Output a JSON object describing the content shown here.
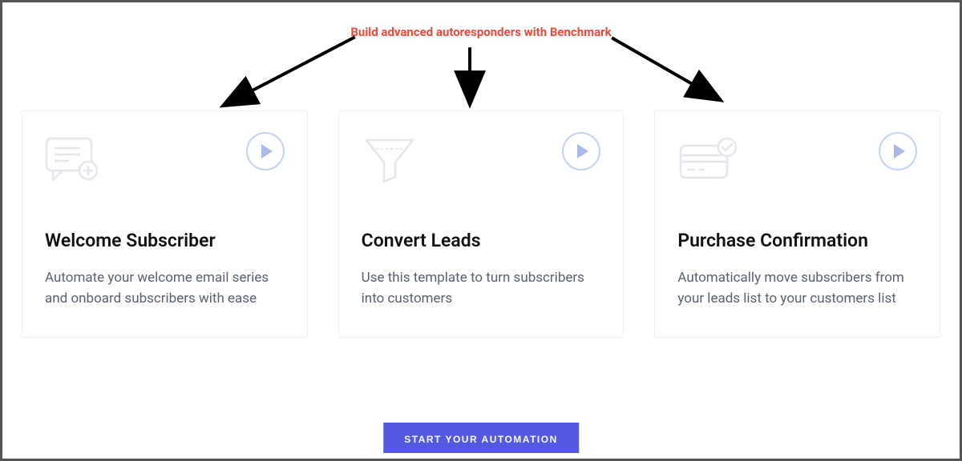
{
  "annotation": {
    "title": "Build advanced autoresponders with Benchmark"
  },
  "cards": [
    {
      "icon": "chat-plus-icon",
      "title": "Welcome Subscriber",
      "description": "Automate your welcome email series and onboard subscribers with ease"
    },
    {
      "icon": "funnel-icon",
      "title": "Convert Leads",
      "description": "Use this template to turn subscribers into customers"
    },
    {
      "icon": "card-check-icon",
      "title": "Purchase Confirmation",
      "description": "Automatically move subscribers from your leads list to your customers list"
    }
  ],
  "cta": {
    "label": "START YOUR AUTOMATION"
  }
}
